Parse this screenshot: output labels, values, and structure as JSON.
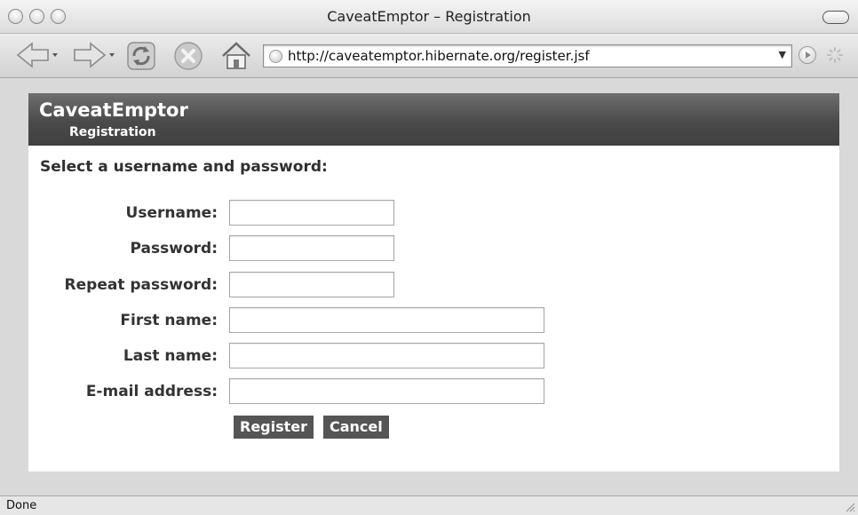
{
  "window": {
    "title": "CaveatEmptor – Registration"
  },
  "toolbar": {
    "url": "http://caveatemptor.hibernate.org/register.jsf",
    "icons": [
      "back-icon",
      "forward-icon",
      "reload-icon",
      "stop-icon",
      "home-icon",
      "go-icon",
      "spinner-icon"
    ]
  },
  "page": {
    "header_title": "CaveatEmptor",
    "header_subtitle": "Registration",
    "form_heading": "Select a username and password:",
    "fields": [
      {
        "label": "Username:",
        "value": ""
      },
      {
        "label": "Password:",
        "value": ""
      },
      {
        "label": "Repeat password:",
        "value": ""
      },
      {
        "label": "First name:",
        "value": ""
      },
      {
        "label": "Last name:",
        "value": ""
      },
      {
        "label": "E-mail address:",
        "value": ""
      }
    ],
    "buttons": {
      "register": "Register",
      "cancel": "Cancel"
    }
  },
  "status": {
    "text": "Done"
  },
  "colors": {
    "header_bg": "#4a4a4a",
    "button_bg": "#555555",
    "chrome_bg": "#d9d9d9"
  }
}
